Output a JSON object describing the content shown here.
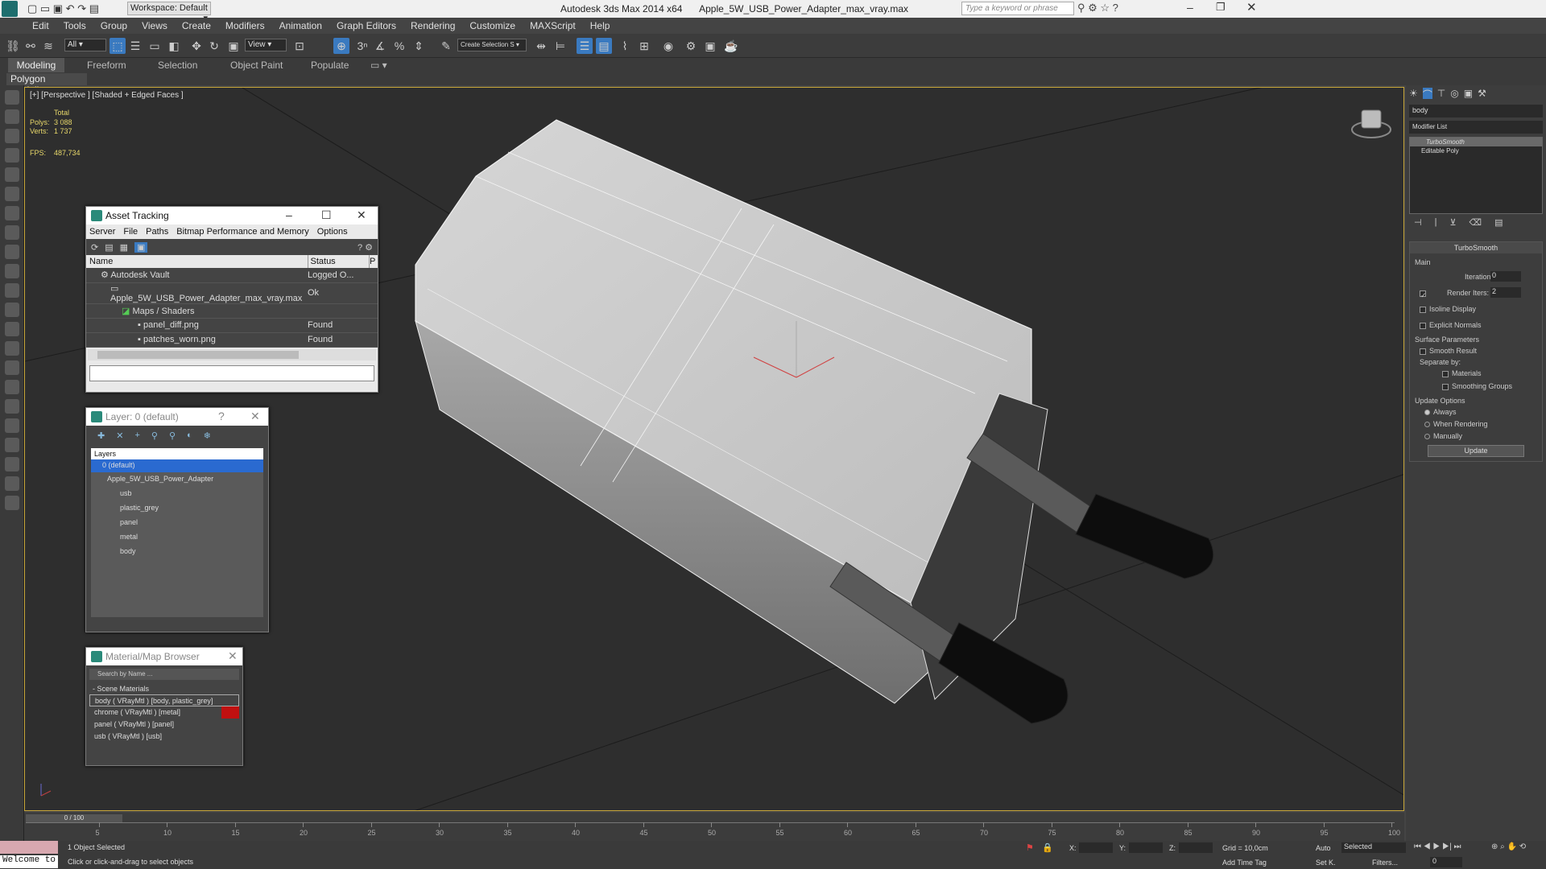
{
  "titlebar": {
    "workspace": "Workspace: Default",
    "app": "Autodesk 3ds Max  2014 x64",
    "file": "Apple_5W_USB_Power_Adapter_max_vray.max",
    "search_placeholder": "Type a keyword or phrase"
  },
  "menu": [
    "Edit",
    "Tools",
    "Group",
    "Views",
    "Create",
    "Modifiers",
    "Animation",
    "Graph Editors",
    "Rendering",
    "Customize",
    "MAXScript",
    "Help"
  ],
  "toolbar": {
    "selection_filter": "All",
    "ref_coord": "View",
    "named_selection": "Create Selection S"
  },
  "ribbon": {
    "tabs": [
      "Modeling",
      "Freeform",
      "Selection",
      "Object Paint",
      "Populate"
    ],
    "sub": "Polygon Modeling"
  },
  "viewport": {
    "label": "[+] [Perspective ] [Shaded + Edged Faces ]",
    "stats": {
      "total": "Total",
      "polys_label": "Polys:",
      "polys": "3 088",
      "verts_label": "Verts:",
      "verts": "1 737",
      "fps_label": "FPS:",
      "fps": "487,734"
    }
  },
  "asset_tracking": {
    "title": "Asset Tracking",
    "menu": [
      "Server",
      "File",
      "Paths",
      "Bitmap Performance and Memory",
      "Options"
    ],
    "columns": [
      "Name",
      "Status",
      "P"
    ],
    "rows": [
      {
        "name": "Autodesk Vault",
        "status": "Logged O..."
      },
      {
        "name": "Apple_5W_USB_Power_Adapter_max_vray.max",
        "status": "Ok"
      },
      {
        "name": "Maps / Shaders",
        "status": ""
      },
      {
        "name": "panel_diff.png",
        "status": "Found"
      },
      {
        "name": "patches_worn.png",
        "status": "Found"
      }
    ]
  },
  "layer": {
    "title": "Layer: 0 (default)",
    "help": "?",
    "header": "Layers",
    "items": [
      "0 (default)",
      "Apple_5W_USB_Power_Adapter",
      "usb",
      "plastic_grey",
      "panel",
      "metal",
      "body"
    ]
  },
  "material_browser": {
    "title": "Material/Map Browser",
    "search_placeholder": "Search by Name ...",
    "section": "- Scene Materials",
    "items": [
      "body ( VRayMtl ) [body, plastic_grey]",
      "chrome ( VRayMtl ) [metal]",
      "panel ( VRayMtl ) [panel]",
      "usb ( VRayMtl ) [usb]"
    ]
  },
  "command_panel": {
    "object_name": "body",
    "modifier_list": "Modifier List",
    "stack": [
      "TurboSmooth",
      "Editable Poly"
    ],
    "rollout_title": "TurboSmooth",
    "main": "Main",
    "iterations_label": "Iterations:",
    "iterations": "0",
    "render_iters_label": "Render Iters:",
    "render_iters": "2",
    "isoline": "Isoline Display",
    "explicit": "Explicit Normals",
    "surface": "Surface Parameters",
    "smooth_result": "Smooth Result",
    "separate_by": "Separate by:",
    "materials": "Materials",
    "smoothing_groups": "Smoothing Groups",
    "update_options": "Update Options",
    "always": "Always",
    "when_rendering": "When Rendering",
    "manually": "Manually",
    "update_btn": "Update"
  },
  "timeline": {
    "frame": "0 / 100",
    "ticks": [
      "5",
      "10",
      "15",
      "20",
      "25",
      "30",
      "35",
      "40",
      "45",
      "50",
      "55",
      "60",
      "65",
      "70",
      "75",
      "80",
      "85",
      "90",
      "95",
      "100"
    ]
  },
  "status": {
    "selected": "1 Object Selected",
    "hint": "Click or click-and-drag to select objects",
    "welcome": "Welcome to",
    "x_label": "X:",
    "y_label": "Y:",
    "z_label": "Z:",
    "grid": "Grid = 10,0cm",
    "add_time_tag": "Add Time Tag",
    "auto": "Auto",
    "set_key": "Set K.",
    "selected_mode": "Selected",
    "filters": "Filters...",
    "frame_field": "0"
  }
}
